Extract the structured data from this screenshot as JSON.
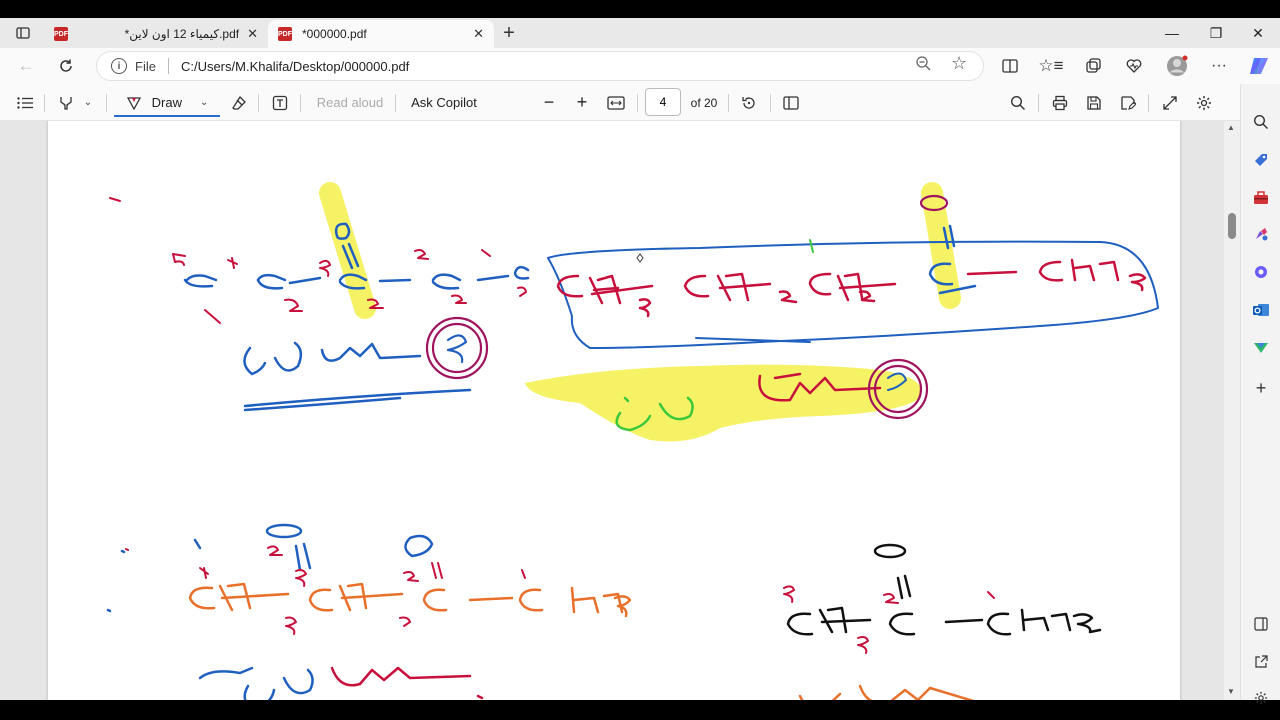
{
  "tabs": [
    {
      "title": "*كيمياء 12 اون لاين.pdf",
      "active": false
    },
    {
      "title": "*000000.pdf",
      "active": true
    }
  ],
  "address": {
    "scheme_label": "File",
    "url": "C:/Users/M.Khalifa/Desktop/000000.pdf"
  },
  "pdf_toolbar": {
    "draw_label": "Draw",
    "read_aloud_label": "Read aloud",
    "ask_copilot_label": "Ask Copilot",
    "page_current": "4",
    "page_total_label": "of 20"
  },
  "window": {
    "minimize": "—",
    "restore": "❐",
    "close": "✕"
  },
  "ink_colors": {
    "blue": "#1f5fbf",
    "red": "#c8103c",
    "orange": "#e8702a",
    "black": "#111111",
    "purple": "#a0135f",
    "green": "#3cc83c",
    "yellow": "#f5f04a"
  }
}
